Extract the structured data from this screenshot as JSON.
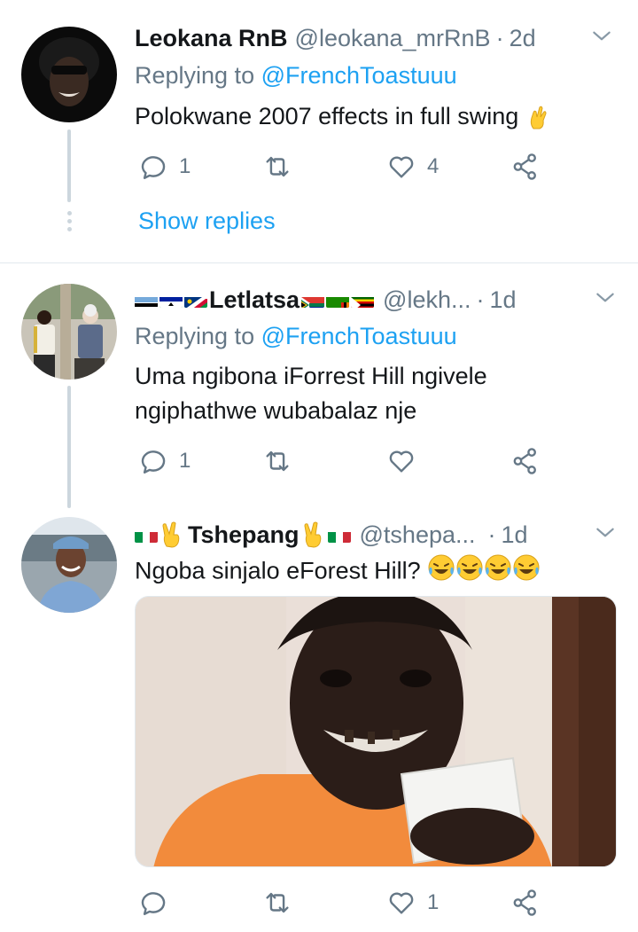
{
  "tweets": [
    {
      "name": "Leokana RnB",
      "handle": "@leokana_mrRnB",
      "sep": "·",
      "time": "2d",
      "replying_prefix": "Replying to ",
      "replying_to": "@FrenchToastuuu",
      "text": "Polokwane 2007 effects in full swing",
      "emoji_name": "crossed-fingers",
      "reply_count": "1",
      "retweet_count": "",
      "like_count": "4",
      "show_replies": "Show replies"
    },
    {
      "name": "Letlatsa",
      "handle": "@lekh...",
      "sep": "·",
      "time": "1d",
      "replying_prefix": "Replying to ",
      "replying_to": "@FrenchToastuuu",
      "text": "Uma ngibona iForrest Hill ngivele ngiphathwe wubabalaz nje",
      "reply_count": "1",
      "retweet_count": "",
      "like_count": ""
    },
    {
      "name": "Tshepang",
      "handle": "@tshepa...",
      "sep": "·",
      "time": "1d",
      "text": "Ngoba sinjalo eForest Hill?",
      "emoji_name": "laughing-tears",
      "reply_count": "",
      "retweet_count": "",
      "like_count": "1"
    }
  ],
  "colors": {
    "link": "#1da1f2",
    "muted": "#657786",
    "divider": "#e1e8ed",
    "thread": "#ccd6dd"
  },
  "icons": [
    "reply-icon",
    "retweet-icon",
    "like-icon",
    "share-icon",
    "chevron-down-icon"
  ]
}
